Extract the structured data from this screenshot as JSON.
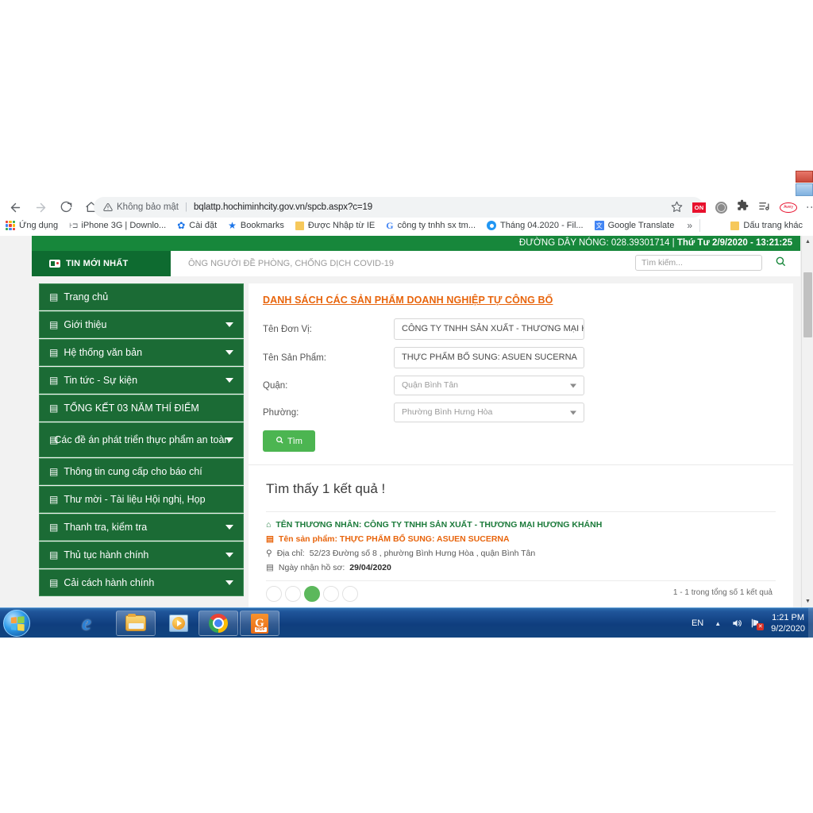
{
  "browser": {
    "nav": {
      "back_icon": "arrow-left-icon",
      "forward_icon": "arrow-right-icon",
      "reload_icon": "reload-icon",
      "home_icon": "home-icon"
    },
    "omnibox": {
      "security_label": "Không bảo mật",
      "url": "bqlattp.hochiminhcity.gov.vn/spcb.aspx?c=19",
      "warning_icon": "warning-triangle-icon",
      "star_icon": "bookmark-star-icon"
    },
    "extensions": [
      {
        "name": "adblock-on-extension",
        "label": "ON"
      },
      {
        "name": "globe-extension",
        "label": ""
      },
      {
        "name": "puzzle-extensions-icon",
        "label": ""
      },
      {
        "name": "reading-list-icon",
        "label": ""
      },
      {
        "name": "oval-extension",
        "label": "Avery"
      }
    ],
    "menu_icon": "kebab-menu-icon",
    "bookmarks": [
      {
        "icon": "apps-grid-icon",
        "label": "Ứng dụng"
      },
      {
        "icon": "hd-icon",
        "label": "iPhone 3G | Downlo..."
      },
      {
        "icon": "gear-icon",
        "label": "Cài đặt"
      },
      {
        "icon": "star-icon",
        "label": "Bookmarks"
      },
      {
        "icon": "folder-icon",
        "label": "Được Nhập từ IE"
      },
      {
        "icon": "google-icon",
        "label": "công ty tnhh sx tm..."
      },
      {
        "icon": "blue-circle-icon",
        "label": "Tháng 04.2020 - Fil..."
      },
      {
        "icon": "translate-icon",
        "label": "Google Translate"
      }
    ],
    "bookmarks_overflow": "»",
    "other_bookmarks": {
      "icon": "folder-icon",
      "label": "Dấu trang khác"
    }
  },
  "site": {
    "topbar": {
      "hotline_label": "ĐƯỜNG DÂY NÓNG:",
      "hotline_number": "028.39301714",
      "separator": "|",
      "datetime": "Thứ Tư 2/9/2020 - 13:21:25"
    },
    "newsbar": {
      "badge_label": "TIN MỚI NHẤT",
      "badge_icon": "tv-news-icon",
      "ticker_text": "ÔNG NGƯỜI ĐỀ PHÒNG, CHỐNG DỊCH COVID-19",
      "search_placeholder": "Tìm kiếm...",
      "search_icon": "search-icon"
    },
    "sidebar": {
      "items": [
        {
          "label": "Trang chủ",
          "icon": "list-icon",
          "has_caret": false
        },
        {
          "label": "Giới thiệu",
          "icon": "list-icon",
          "has_caret": true
        },
        {
          "label": "Hệ thống văn bản",
          "icon": "list-icon",
          "has_caret": true
        },
        {
          "label": "Tin tức - Sự kiện",
          "icon": "list-icon",
          "has_caret": true
        },
        {
          "label": "TỔNG KẾT 03 NĂM THÍ ĐIỂM",
          "icon": "list-icon",
          "has_caret": false
        },
        {
          "label": "Các đề án phát triển thực phẩm an toàn",
          "icon": "list-icon",
          "has_caret": true
        },
        {
          "label": "Thông tin cung cấp cho báo chí",
          "icon": "list-icon",
          "has_caret": false
        },
        {
          "label": "Thư mời - Tài liệu Hội nghị, Họp",
          "icon": "list-icon",
          "has_caret": false
        },
        {
          "label": "Thanh tra, kiểm tra",
          "icon": "list-icon",
          "has_caret": true
        },
        {
          "label": "Thủ tục hành chính",
          "icon": "list-icon",
          "has_caret": true
        },
        {
          "label": "Cải cách hành chính",
          "icon": "list-icon",
          "has_caret": true
        }
      ]
    },
    "form": {
      "title": "DANH SÁCH CÁC SẢN PHẨM DOANH NGHIỆP TỰ CÔNG BỐ",
      "fields": {
        "unit_label": "Tên Đơn Vị:",
        "unit_value": "CÔNG TY TNHH SẢN XUẤT - THƯƠNG MẠI H",
        "product_label": "Tên Sản Phẩm:",
        "product_value": "THỰC PHẨM BỔ SUNG: ASUEN SUCERNA",
        "district_label": "Quận:",
        "district_value": "Quận Bình Tân",
        "ward_label": "Phường:",
        "ward_value": "Phường Bình Hưng Hòa"
      },
      "search_button": {
        "label": "Tìm",
        "icon": "search-icon"
      }
    },
    "results": {
      "count_text": "Tìm thấy 1 kết quả !",
      "items": [
        {
          "merchant_icon": "home-icon",
          "merchant_text": "TÊN THƯƠNG NHÂN: CÔNG TY TNHH SẢN XUẤT - THƯƠNG MẠI HƯƠNG KHÁNH",
          "product_icon": "list-icon",
          "product_text": "Tên sản phẩm: THỰC PHẨM BỔ SUNG: ASUEN SUCERNA",
          "address_icon": "map-pin-icon",
          "address_label": "Địa chỉ:",
          "address_text": "52/23 Đường số 8 , phường Bình Hưng Hòa , quận Bình Tân",
          "date_icon": "calendar-icon",
          "date_label": "Ngày nhận hồ sơ:",
          "date_value": "29/04/2020"
        }
      ],
      "pager_note": "1 - 1 trong tổng số 1 kết quả"
    },
    "colors": {
      "header_green": "#17873b",
      "menu_green": "#1b6b35",
      "title_orange": "#e8650d",
      "merchant_green": "#1b7a3a",
      "button_green": "#4cb551"
    }
  },
  "taskbar": {
    "start_label": "start-orb",
    "buttons": [
      {
        "name": "internet-explorer",
        "icon": "ie-icon"
      },
      {
        "name": "windows-explorer",
        "icon": "folder-icon"
      },
      {
        "name": "windows-media-player",
        "icon": "media-player-icon"
      },
      {
        "name": "google-chrome",
        "icon": "chrome-icon"
      },
      {
        "name": "pdf-reader",
        "icon": "pdf-icon"
      }
    ],
    "tray": {
      "language": "EN",
      "show_hidden_icon": "chevron-up-icon",
      "volume_icon": "speaker-icon",
      "network_icon": "network-error-icon",
      "time": "1:21 PM",
      "date": "9/2/2020"
    }
  }
}
